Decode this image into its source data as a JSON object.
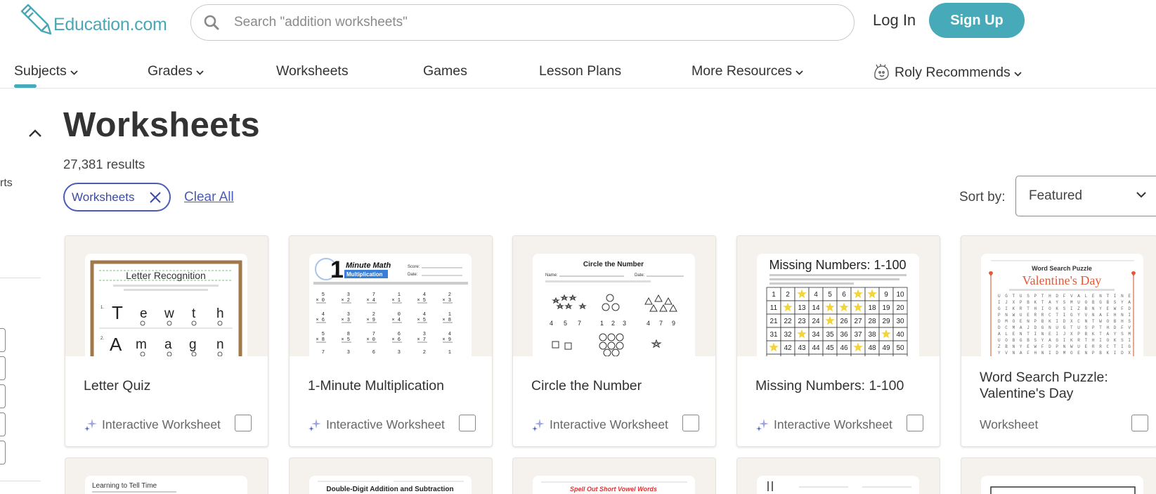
{
  "header": {
    "logo_text": "Education.com",
    "search_placeholder": "Search \"addition worksheets\"",
    "login_label": "Log In",
    "signup_label": "Sign Up"
  },
  "nav": {
    "items": [
      {
        "label": "Subjects",
        "dropdown": true
      },
      {
        "label": "Grades",
        "dropdown": true
      },
      {
        "label": "Worksheets",
        "dropdown": false
      },
      {
        "label": "Games",
        "dropdown": false
      },
      {
        "label": "Lesson Plans",
        "dropdown": false
      },
      {
        "label": "More Resources",
        "dropdown": true
      },
      {
        "label": "Roly Recommends",
        "dropdown": true
      }
    ]
  },
  "sidebar": {
    "partial_text": "rts"
  },
  "main": {
    "title": "Worksheets",
    "results": "27,381 results",
    "filter_chip": "Worksheets",
    "clear_all": "Clear All",
    "sort_label": "Sort by:",
    "sort_value": "Featured"
  },
  "cards": [
    {
      "title": "Letter Quiz",
      "type": "Interactive Worksheet",
      "interactive": true,
      "thumb": {
        "heading": "Letter Recognition"
      }
    },
    {
      "title": "1-Minute Multiplication",
      "type": "Interactive Worksheet",
      "interactive": true,
      "thumb": {
        "heading": "Minute Math",
        "subheading": "Multiplication",
        "score_label": "Score:",
        "date_label": "Date:"
      }
    },
    {
      "title": "Circle the Number",
      "type": "Interactive Worksheet",
      "interactive": true,
      "thumb": {
        "heading": "Circle the Number",
        "name_label": "Name:",
        "date_label": "Date:"
      }
    },
    {
      "title": "Missing Numbers: 1-100",
      "type": "Interactive Worksheet",
      "interactive": true,
      "thumb": {
        "heading": "Missing Numbers: 1-100"
      }
    },
    {
      "title": "Word Search Puzzle: Valentine's Day",
      "type": "Worksheet",
      "interactive": false,
      "thumb": {
        "heading": "Word Search Puzzle",
        "subheading": "Valentine's Day"
      }
    }
  ],
  "cards_row2": [
    {
      "thumb_heading": "Learning to Tell Time"
    },
    {
      "thumb_heading": "Double-Digit Addition and Subtraction"
    },
    {
      "thumb_heading": "Spell Out Short Vowel Words"
    },
    {
      "thumb_heading": ""
    },
    {
      "thumb_heading": ""
    }
  ],
  "colors": {
    "brand_teal": "#46aab8",
    "chip_blue": "#4b5cb8",
    "card_bg": "#f5f1ec",
    "valentine_red": "#e05a3a",
    "star_yellow": "#f3d43a"
  }
}
